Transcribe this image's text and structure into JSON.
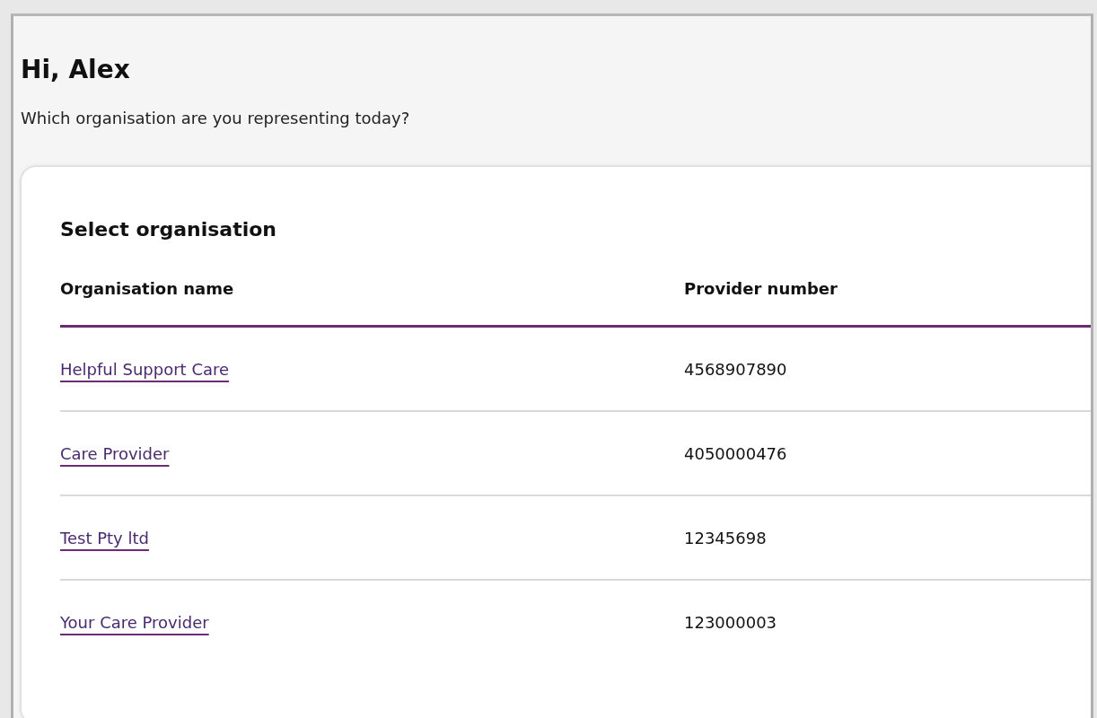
{
  "greeting": "Hi, Alex",
  "prompt": "Which organisation are you representing today?",
  "card": {
    "title": "Select organisation",
    "table": {
      "columns": [
        "Organisation name",
        "Provider number"
      ],
      "rows": [
        {
          "name": "Helpful Support Care",
          "provider_number": "4568907890"
        },
        {
          "name": "Care Provider",
          "provider_number": "4050000476"
        },
        {
          "name": "Test Pty ltd",
          "provider_number": "12345698"
        },
        {
          "name": "Your Care Provider",
          "provider_number": "123000003"
        }
      ]
    }
  }
}
